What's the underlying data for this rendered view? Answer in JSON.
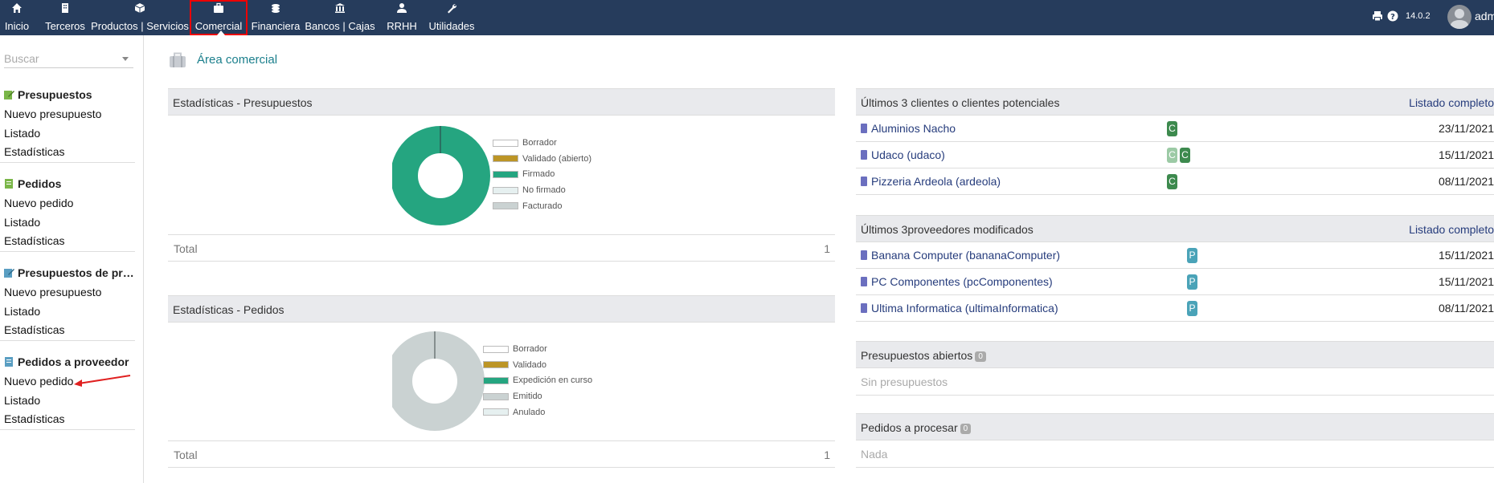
{
  "topbar": {
    "menu": [
      {
        "label": "Inicio",
        "icon": "home-icon"
      },
      {
        "label": "Terceros",
        "icon": "building-icon"
      },
      {
        "label": "Productos | Servicios",
        "icon": "cube-icon"
      },
      {
        "label": "Comercial",
        "icon": "suitcase-icon"
      },
      {
        "label": "Financiera",
        "icon": "coins-icon"
      },
      {
        "label": "Bancos | Cajas",
        "icon": "bank-icon"
      },
      {
        "label": "RRHH",
        "icon": "user-tie-icon"
      },
      {
        "label": "Utilidades",
        "icon": "wrench-icon"
      }
    ],
    "version": "14.0.2",
    "user": "adm"
  },
  "sidebar": {
    "search_placeholder": "Buscar",
    "groups": [
      {
        "title": "Presupuestos",
        "links": [
          "Nuevo presupuesto",
          "Listado",
          "Estadísticas"
        ]
      },
      {
        "title": "Pedidos",
        "links": [
          "Nuevo pedido",
          "Listado",
          "Estadísticas"
        ]
      },
      {
        "title": "Presupuestos de pro…",
        "links": [
          "Nuevo presupuesto",
          "Listado",
          "Estadísticas"
        ]
      },
      {
        "title": "Pedidos a proveedor",
        "links": [
          "Nuevo pedido",
          "Listado",
          "Estadísticas"
        ]
      }
    ]
  },
  "main": {
    "title": "Área comercial",
    "stats_presupuestos": {
      "header": "Estadísticas - Presupuestos",
      "total_label": "Total",
      "total_value": "1",
      "legend": [
        {
          "label": "Borrador",
          "color": "#ffffff"
        },
        {
          "label": "Validado (abierto)",
          "color": "#bc9526"
        },
        {
          "label": "Firmado",
          "color": "#25a580"
        },
        {
          "label": "No firmado",
          "color": "#e6f0f0"
        },
        {
          "label": "Facturado",
          "color": "#cad2d2"
        }
      ],
      "donut": [
        0,
        0,
        1,
        0,
        0
      ]
    },
    "stats_pedidos": {
      "header": "Estadísticas - Pedidos",
      "total_label": "Total",
      "total_value": "1",
      "legend": [
        {
          "label": "Borrador",
          "color": "#ffffff"
        },
        {
          "label": "Validado",
          "color": "#bc9526"
        },
        {
          "label": "Expedición en curso",
          "color": "#25a580"
        },
        {
          "label": "Emitido",
          "color": "#cad2d2"
        },
        {
          "label": "Anulado",
          "color": "#e6f0f0"
        }
      ],
      "donut": [
        0,
        0,
        0,
        1,
        0
      ]
    },
    "clientes": {
      "header": "Últimos 3 clientes o clientes potenciales",
      "link": "Listado completo",
      "rows": [
        {
          "name": "Aluminios Nacho",
          "badges": [
            "C"
          ],
          "date": "23/11/2021"
        },
        {
          "name": "Udaco (udaco)",
          "badges": [
            "C",
            "C"
          ],
          "date": "15/11/2021"
        },
        {
          "name": "Pizzeria Ardeola (ardeola)",
          "badges": [
            "C"
          ],
          "date": "08/11/2021"
        }
      ]
    },
    "proveedores": {
      "header": "Últimos 3proveedores modificados",
      "link": "Listado completo",
      "rows": [
        {
          "name": "Banana Computer (bananaComputer)",
          "badges": [
            "P"
          ],
          "date": "15/11/2021"
        },
        {
          "name": "PC Componentes (pcComponentes)",
          "badges": [
            "P"
          ],
          "date": "15/11/2021"
        },
        {
          "name": "Ultima Informatica (ultimaInformatica)",
          "badges": [
            "P"
          ],
          "date": "08/11/2021"
        }
      ]
    },
    "presupuestos_abiertos": {
      "header": "Presupuestos abiertos",
      "count": "0",
      "empty": "Sin presupuestos"
    },
    "pedidos_procesar": {
      "header": "Pedidos a procesar",
      "count": "0",
      "empty": "Nada"
    }
  },
  "colors": {
    "topbar": "#263c5c",
    "accent": "#1b7f8c",
    "badge_c": "#3d8a4e",
    "badge_c_light": "#9ccaa5",
    "badge_p": "#4aa3b8"
  }
}
